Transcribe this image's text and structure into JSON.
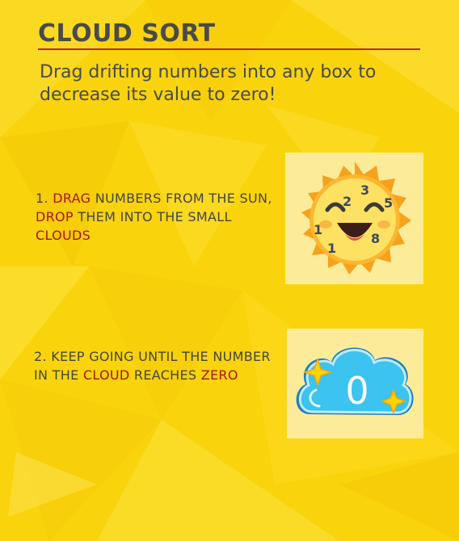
{
  "header": {
    "title": "CLOUD SORT",
    "subtitle": "Drag drifting numbers into any box to decrease its value to zero!"
  },
  "steps": [
    {
      "parts": [
        {
          "text": "1. ",
          "highlight": false
        },
        {
          "text": "DRAG",
          "highlight": true
        },
        {
          "text": " NUMBERS FROM THE SUN, ",
          "highlight": false
        },
        {
          "text": "DROP",
          "highlight": true
        },
        {
          "text": " THEM INTO THE SMALL ",
          "highlight": false
        },
        {
          "text": "CLOUDS",
          "highlight": true
        }
      ]
    },
    {
      "parts": [
        {
          "text": "2. KEEP GOING UNTIL THE NUMBER IN THE ",
          "highlight": false
        },
        {
          "text": "CLOUD",
          "highlight": true
        },
        {
          "text": " REACHES ",
          "highlight": false
        },
        {
          "text": "ZERO",
          "highlight": true
        }
      ]
    }
  ],
  "sun_numbers": [
    "3",
    "2",
    "5",
    "1",
    "8",
    "1"
  ],
  "cloud_value": "0",
  "colors": {
    "background": "#f9d40c",
    "accent_red": "#a8141b",
    "text_dark": "#4a4a4a",
    "card": "#fcec9a",
    "sun_fill": "#fde163",
    "sun_rays": "#f7a11c",
    "cloud_fill": "#3cc3ef",
    "sparkle": "#ffd400"
  },
  "icons": [
    "sun-icon",
    "cloud-icon",
    "sparkle-icon"
  ]
}
